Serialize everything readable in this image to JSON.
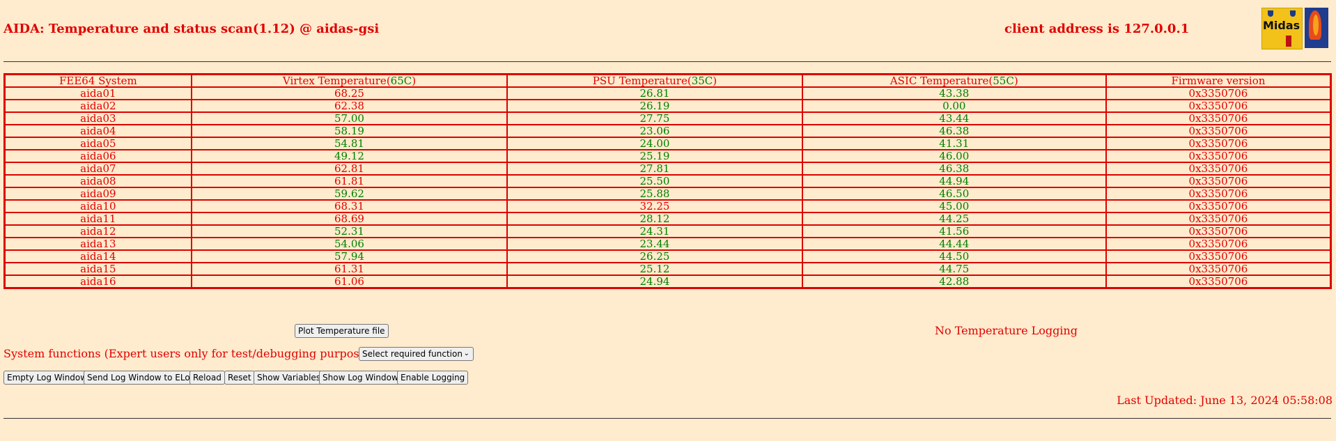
{
  "header": {
    "title": "AIDA: Temperature and status scan(1.12) @ aidas-gsi",
    "client_address": "client address is 127.0.0.1",
    "logo_text": "Midas"
  },
  "table": {
    "headers": {
      "system": "FEE64 System",
      "virtex": "Virtex Temperature(",
      "virtex_limit": "65C",
      "psu": "PSU Temperature(",
      "psu_limit": "35C",
      "asic": "ASIC Temperature(",
      "asic_limit": "55C",
      "close": ")",
      "firmware": "Firmware version"
    },
    "rows": [
      {
        "name": "aida01",
        "virtex": "68.25",
        "psu": "26.81",
        "asic": "43.38",
        "fw": "0x3350706"
      },
      {
        "name": "aida02",
        "virtex": "62.38",
        "psu": "26.19",
        "asic": "0.00",
        "fw": "0x3350706"
      },
      {
        "name": "aida03",
        "virtex": "57.00",
        "psu": "27.75",
        "asic": "43.44",
        "fw": "0x3350706"
      },
      {
        "name": "aida04",
        "virtex": "58.19",
        "psu": "23.06",
        "asic": "46.38",
        "fw": "0x3350706"
      },
      {
        "name": "aida05",
        "virtex": "54.81",
        "psu": "24.00",
        "asic": "41.31",
        "fw": "0x3350706"
      },
      {
        "name": "aida06",
        "virtex": "49.12",
        "psu": "25.19",
        "asic": "46.00",
        "fw": "0x3350706"
      },
      {
        "name": "aida07",
        "virtex": "62.81",
        "psu": "27.81",
        "asic": "46.38",
        "fw": "0x3350706"
      },
      {
        "name": "aida08",
        "virtex": "61.81",
        "psu": "25.50",
        "asic": "44.94",
        "fw": "0x3350706"
      },
      {
        "name": "aida09",
        "virtex": "59.62",
        "psu": "25.88",
        "asic": "46.50",
        "fw": "0x3350706"
      },
      {
        "name": "aida10",
        "virtex": "68.31",
        "psu": "32.25",
        "asic": "45.00",
        "fw": "0x3350706"
      },
      {
        "name": "aida11",
        "virtex": "68.69",
        "psu": "28.12",
        "asic": "44.25",
        "fw": "0x3350706"
      },
      {
        "name": "aida12",
        "virtex": "52.31",
        "psu": "24.31",
        "asic": "41.56",
        "fw": "0x3350706"
      },
      {
        "name": "aida13",
        "virtex": "54.06",
        "psu": "23.44",
        "asic": "44.44",
        "fw": "0x3350706"
      },
      {
        "name": "aida14",
        "virtex": "57.94",
        "psu": "26.25",
        "asic": "44.50",
        "fw": "0x3350706"
      },
      {
        "name": "aida15",
        "virtex": "61.31",
        "psu": "25.12",
        "asic": "44.75",
        "fw": "0x3350706"
      },
      {
        "name": "aida16",
        "virtex": "61.06",
        "psu": "24.94",
        "asic": "42.88",
        "fw": "0x3350706"
      }
    ]
  },
  "controls": {
    "plot_button": "Plot Temperature file",
    "logging_status": "No Temperature Logging",
    "system_functions_label": "System functions (Expert users only for test/debugging purposes!!!)",
    "function_select": "Select required function",
    "buttons": {
      "empty_log": "Empty Log Window",
      "send_log": "Send Log Window to ELog",
      "reload": "Reload",
      "reset": "Reset",
      "show_variables": "Show Variables",
      "show_log": "Show Log Window",
      "enable_logging": "Enable Logging"
    }
  },
  "footer": {
    "last_updated": "Last Updated: June 13, 2024 05:58:08"
  },
  "colors": {
    "background": "#ffebcd",
    "accent": "#e00000",
    "ok": "#008000"
  }
}
